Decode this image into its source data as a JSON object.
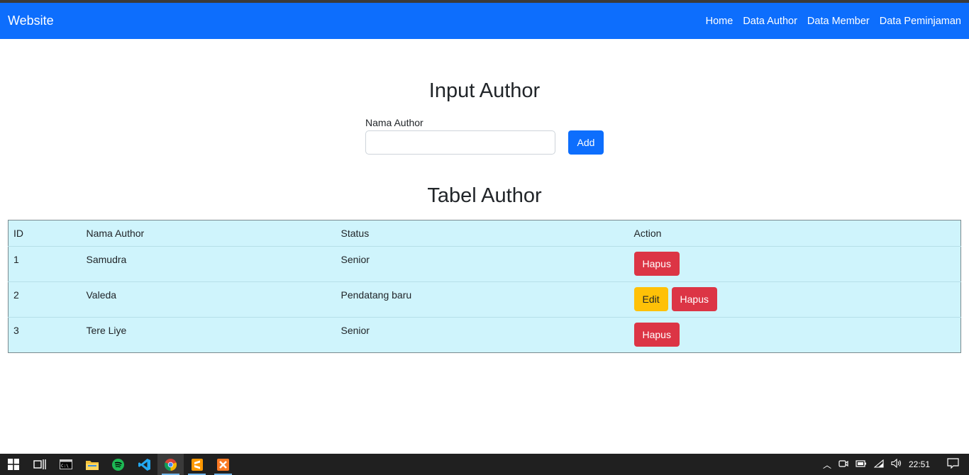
{
  "navbar": {
    "brand": "Website",
    "links": [
      "Home",
      "Data Author",
      "Data Member",
      "Data Peminjaman"
    ]
  },
  "form": {
    "title": "Input Author",
    "label": "Nama Author",
    "value": "",
    "placeholder": "",
    "add_label": "Add"
  },
  "table": {
    "title": "Tabel Author",
    "headers": [
      "ID",
      "Nama Author",
      "Status",
      "Action"
    ],
    "rows": [
      {
        "id": "1",
        "name": "Samudra",
        "status": "Senior",
        "edit": "",
        "hapus": "Hapus"
      },
      {
        "id": "2",
        "name": "Valeda",
        "status": "Pendatang baru",
        "edit": "Edit",
        "hapus": "Hapus"
      },
      {
        "id": "3",
        "name": "Tere Liye",
        "status": "Senior",
        "edit": "",
        "hapus": "Hapus"
      }
    ]
  },
  "taskbar": {
    "apps": [
      "windows-start-icon",
      "task-view-icon",
      "terminal-icon",
      "file-explorer-icon",
      "spotify-icon",
      "vscode-icon",
      "chrome-icon",
      "sublime-icon",
      "xampp-icon"
    ],
    "clock": "22:51"
  },
  "colors": {
    "primary": "#0d6efd",
    "danger": "#dc3545",
    "warning": "#ffc107",
    "table_bg": "#cff4fc"
  }
}
